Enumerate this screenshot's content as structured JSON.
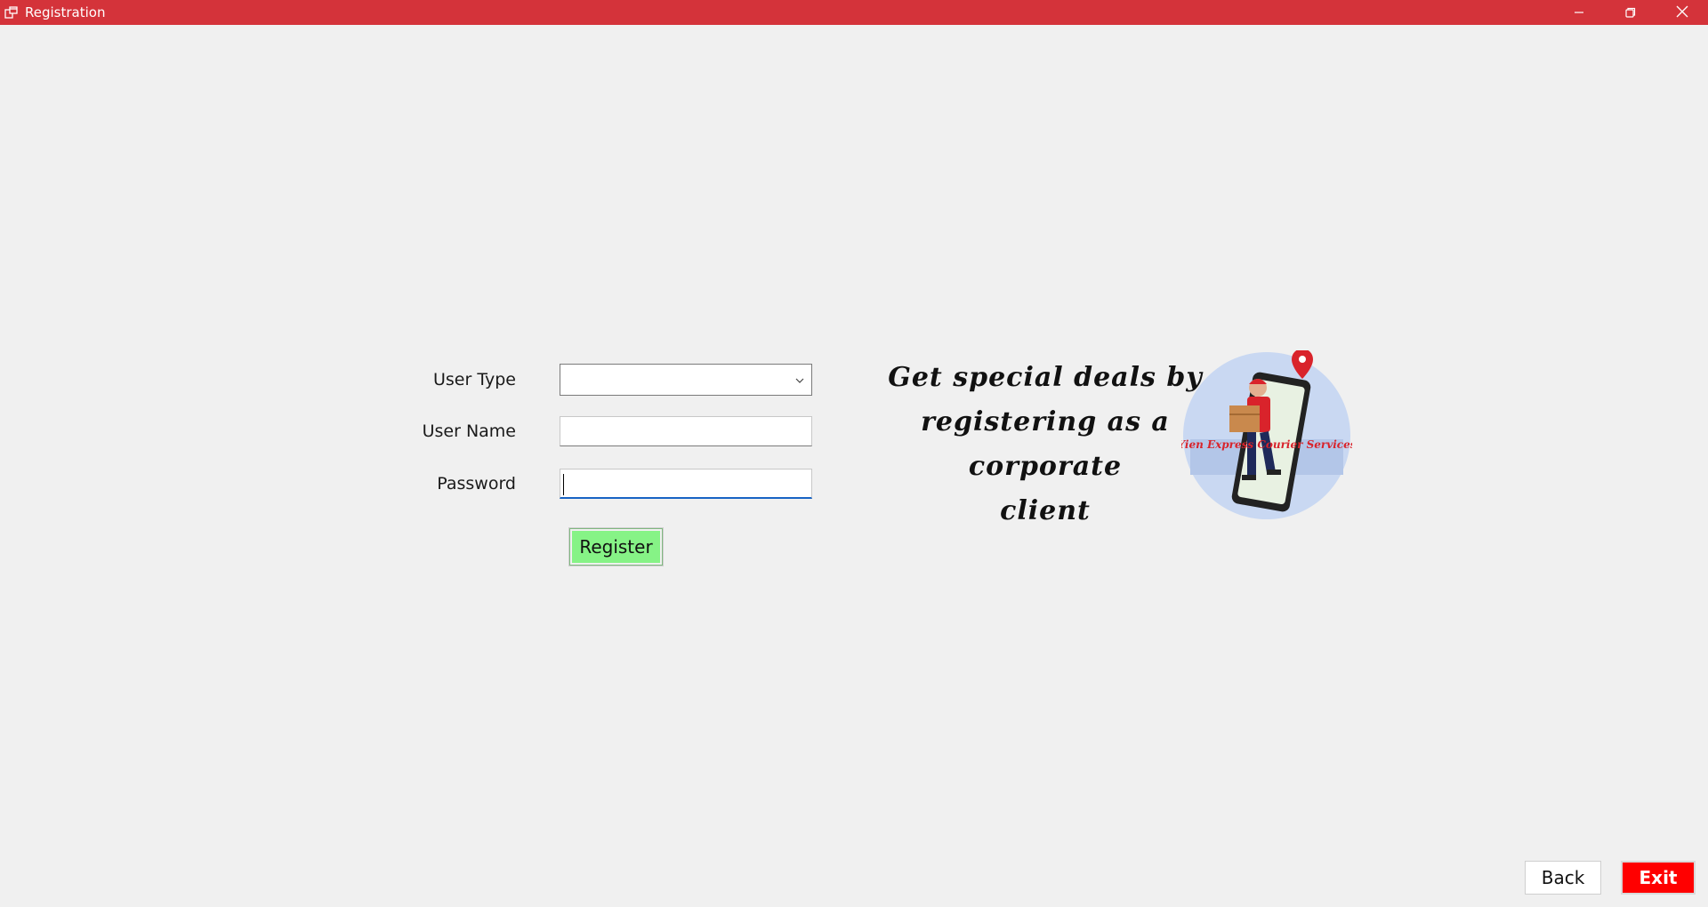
{
  "window": {
    "title": "Registration",
    "titlebar_color": "#d4333a",
    "controls": [
      "minimize-icon",
      "restore-icon",
      "close-icon"
    ]
  },
  "form": {
    "user_type_label": "User Type",
    "user_type_value": "",
    "user_name_label": "User Name",
    "user_name_value": "",
    "password_label": "Password",
    "password_value": "",
    "register_label": "Register",
    "register_color": "#86f386"
  },
  "promo": {
    "line1": "Get special deals by",
    "line2": "registering as a corporate",
    "line3": "client"
  },
  "logo": {
    "text": "Yien Express Courier Services",
    "icon": "courier-delivery-logo"
  },
  "footer": {
    "back_label": "Back",
    "exit_label": "Exit",
    "exit_color": "#ff0000"
  }
}
